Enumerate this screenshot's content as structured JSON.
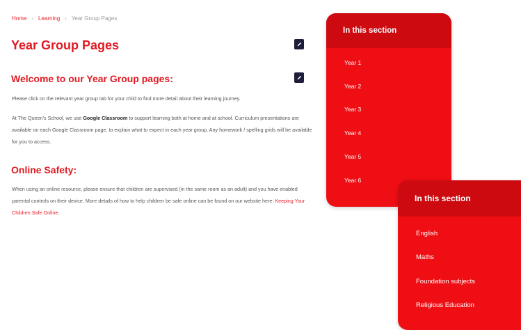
{
  "breadcrumb": {
    "home": "Home",
    "learning": "Learning",
    "current": "Year Group Pages",
    "separator": "›"
  },
  "page": {
    "title": "Year Group Pages"
  },
  "welcome": {
    "heading": "Welcome to our Year Group pages:",
    "para1": "Please click on the relevant year group tab for your child to find more detail about their learning journey.",
    "para2_before": "At The Queen's School, we use ",
    "para2_bold": "Google Classroom",
    "para2_after": " to support learning both at home and at school. Curriculum presentations are available on each Google Classroom page, to explain what to expect in each year group. Any homework / spelling grids will be available for you to access."
  },
  "safety": {
    "heading": "Online Safety:",
    "para_before": "When using an online resource, please ensure that children are supervised (in the same room as an adult) and you have enabled parental controls on their device. More details of how to help children be safe online can be found on our website here: ",
    "link": "Keeping Your Children Safe Online",
    "para_end": "."
  },
  "sidebar": {
    "title": "In this section",
    "items": [
      "Year 1",
      "Year 2",
      "Year 3",
      "Year 4",
      "Year 5",
      "Year 6"
    ]
  },
  "sidebar2": {
    "title": "In this section",
    "items": [
      "English",
      "Maths",
      "Foundation subjects",
      "Religious Education"
    ]
  },
  "icons": {
    "edit": "pencil-icon"
  },
  "colors": {
    "accent_red": "#e11a22",
    "panel_red": "#ee0e14",
    "panel_header_red": "#cc0a10",
    "edit_button": "#1e1e3a"
  }
}
